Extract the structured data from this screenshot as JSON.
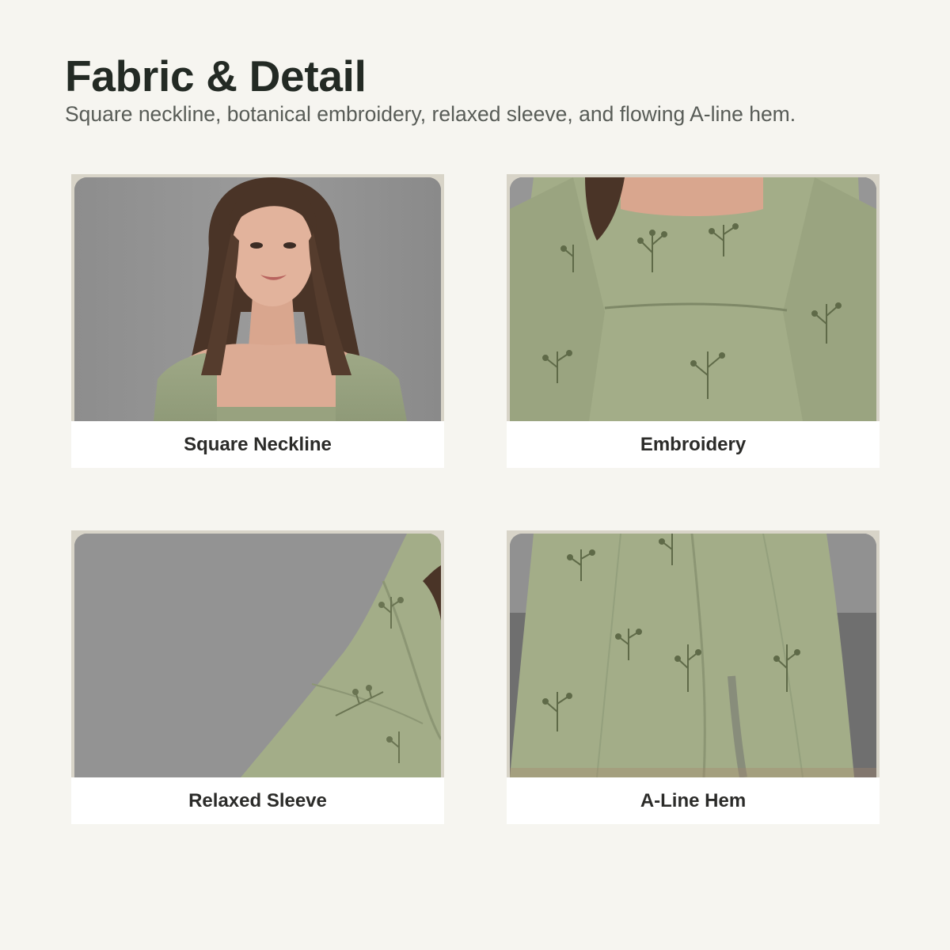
{
  "header": {
    "title": "Fabric & Detail",
    "subtitle": "Square neckline, botanical embroidery, relaxed sleeve, and flowing A-line hem."
  },
  "cards": [
    {
      "label": "Square Neckline",
      "image": "model-neckline-photo"
    },
    {
      "label": "Embroidery",
      "image": "bodice-embroidery-photo"
    },
    {
      "label": "Relaxed Sleeve",
      "image": "sleeve-detail-photo"
    },
    {
      "label": "A-Line Hem",
      "image": "skirt-hem-photo"
    }
  ],
  "colors": {
    "background": "#f6f5f0",
    "title": "#232a24",
    "subtitle": "#585c57",
    "fabric": "#a3ad88",
    "backdrop": "#8f8f8f"
  }
}
